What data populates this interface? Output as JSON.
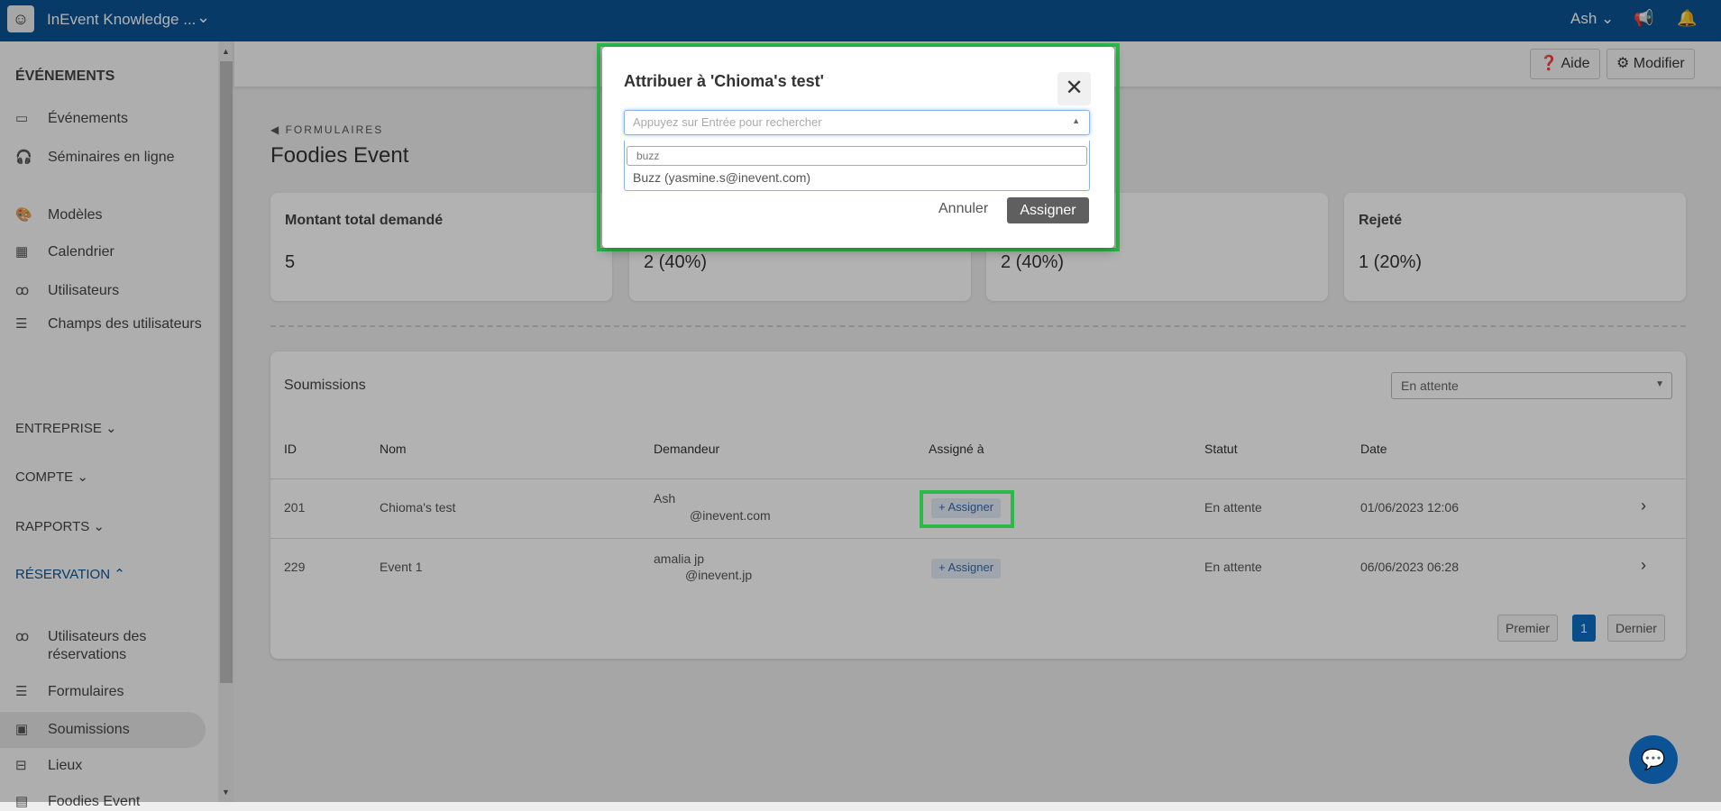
{
  "header": {
    "app_name": "InEvent Knowledge ...",
    "user": "Ash",
    "accent": "#0b5394"
  },
  "sidebar": {
    "section_events": "ÉVÉNEMENTS",
    "events_items": [
      {
        "label": "Événements",
        "icon": "presentation-icon"
      },
      {
        "label": "Séminaires en ligne",
        "icon": "headset-icon"
      },
      {
        "label": "Modèles",
        "icon": "palette-icon"
      },
      {
        "label": "Calendrier",
        "icon": "calendar-icon"
      },
      {
        "label": "Utilisateurs",
        "icon": "users-icon"
      },
      {
        "label": "Champs des utilisateurs",
        "icon": "list-icon"
      }
    ],
    "sections": [
      "ENTREPRISE",
      "COMPTE",
      "RAPPORTS"
    ],
    "section_reservation": "RÉSERVATION",
    "reservation_items": [
      {
        "label": "Utilisateurs des réservations",
        "icon": "users-icon"
      },
      {
        "label": "Formulaires",
        "icon": "list-icon"
      },
      {
        "label": "Soumissions",
        "icon": "contact-card-icon"
      },
      {
        "label": "Lieux",
        "icon": "signpost-icon"
      },
      {
        "label": "Foodies Event",
        "icon": "form-icon"
      }
    ]
  },
  "topbar": {
    "help": "Aide",
    "edit": "Modifier"
  },
  "page": {
    "breadcrumb": "FORMULAIRES",
    "title": "Foodies Event"
  },
  "cards": [
    {
      "label": "Montant total demandé",
      "value": "5"
    },
    {
      "label": "",
      "value": "2 (40%)"
    },
    {
      "label": "",
      "value": "2 (40%)"
    },
    {
      "label": "Rejeté",
      "value": "1 (20%)"
    }
  ],
  "submissions": {
    "title": "Soumissions",
    "filter": "En attente",
    "columns": [
      "ID",
      "Nom",
      "Demandeur",
      "Assigné à",
      "Statut",
      "Date"
    ],
    "rows": [
      {
        "id": "201",
        "name": "Chioma's test",
        "requester": "Ash",
        "email": "@inevent.com",
        "assign": "Assigner",
        "status": "En attente",
        "date": "01/06/2023 12:06"
      },
      {
        "id": "229",
        "name": "Event 1",
        "requester": "amalia jp",
        "email": "@inevent.jp",
        "assign": "Assigner",
        "status": "En attente",
        "date": "06/06/2023 06:28"
      }
    ],
    "pagination": {
      "first": "Premier",
      "current": "1",
      "last": "Dernier"
    }
  },
  "modal": {
    "title": "Attribuer à 'Chioma's test'",
    "placeholder": "Appuyez sur Entrée pour rechercher",
    "search_value": "buzz",
    "option": "Buzz (yasmine.s@inevent.com)",
    "cancel": "Annuler",
    "assign": "Assigner"
  }
}
